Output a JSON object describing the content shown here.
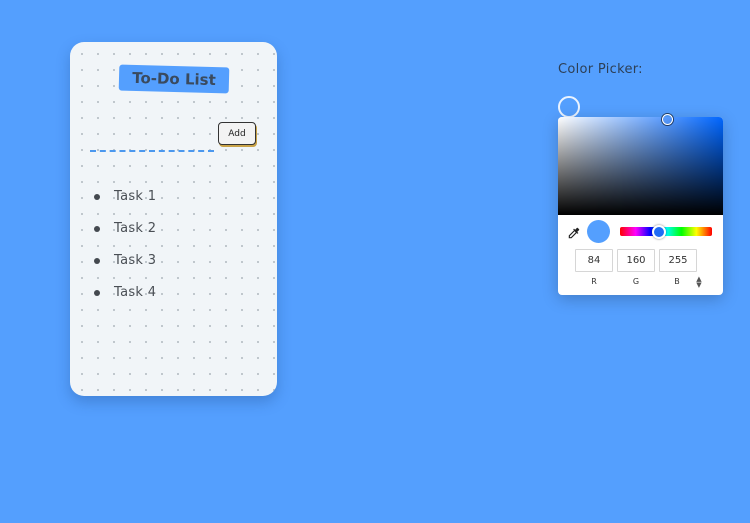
{
  "todo": {
    "title": "To-Do List",
    "add_button_label": "Add",
    "input_value": "",
    "tasks": [
      {
        "label": "Task 1"
      },
      {
        "label": "Task 2"
      },
      {
        "label": "Task 3"
      },
      {
        "label": "Task 4"
      }
    ]
  },
  "color_picker": {
    "label": "Color Picker:",
    "current_color": "#549ffe",
    "rgb": {
      "r": "84",
      "g": "160",
      "b": "255"
    },
    "field_labels": {
      "r": "R",
      "g": "G",
      "b": "B"
    },
    "mode_toggle_icon": "up-down-arrows-icon",
    "eyedropper_icon": "eyedropper-icon"
  },
  "colors": {
    "background": "#549ffe",
    "card": "#f1f5f8",
    "accent": "#549ffe",
    "input_underline": "#4c98ee"
  }
}
